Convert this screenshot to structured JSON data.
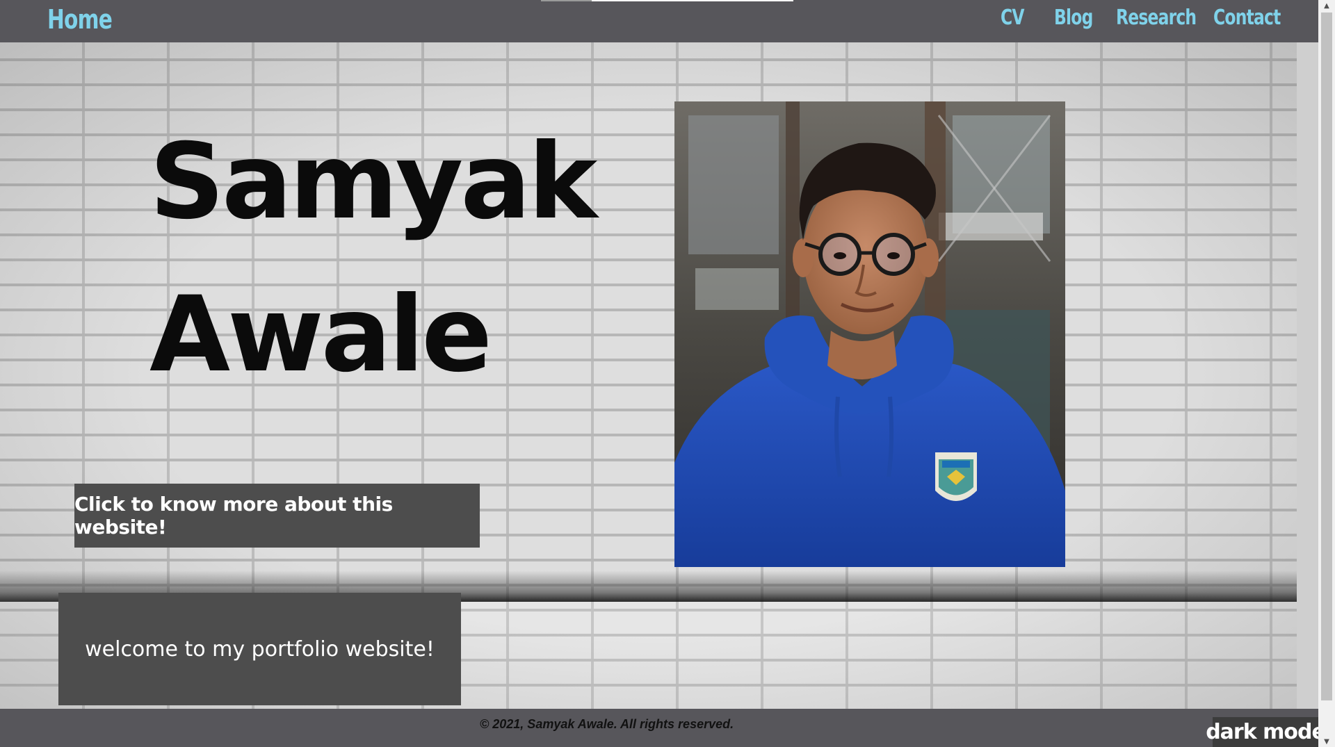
{
  "nav": {
    "home": "Home",
    "links": [
      "CV",
      "Blog",
      "Research",
      "Contact"
    ]
  },
  "hero": {
    "first_name": "Samyak",
    "last_name": "Awale",
    "info_button": "Click to know more about this website!",
    "welcome": "welcome to my portfolio website!"
  },
  "footer": {
    "copyright": "© 2021, Samyak Awale. All rights reserved.",
    "dark_mode": "dark mode"
  },
  "colors": {
    "nav_bg": "#57565b",
    "nav_link": "#7fd2ea",
    "box_bg": "#4d4d4d"
  },
  "icons": {
    "scroll_up": "triangle-up-icon",
    "scroll_down": "triangle-down-icon"
  }
}
